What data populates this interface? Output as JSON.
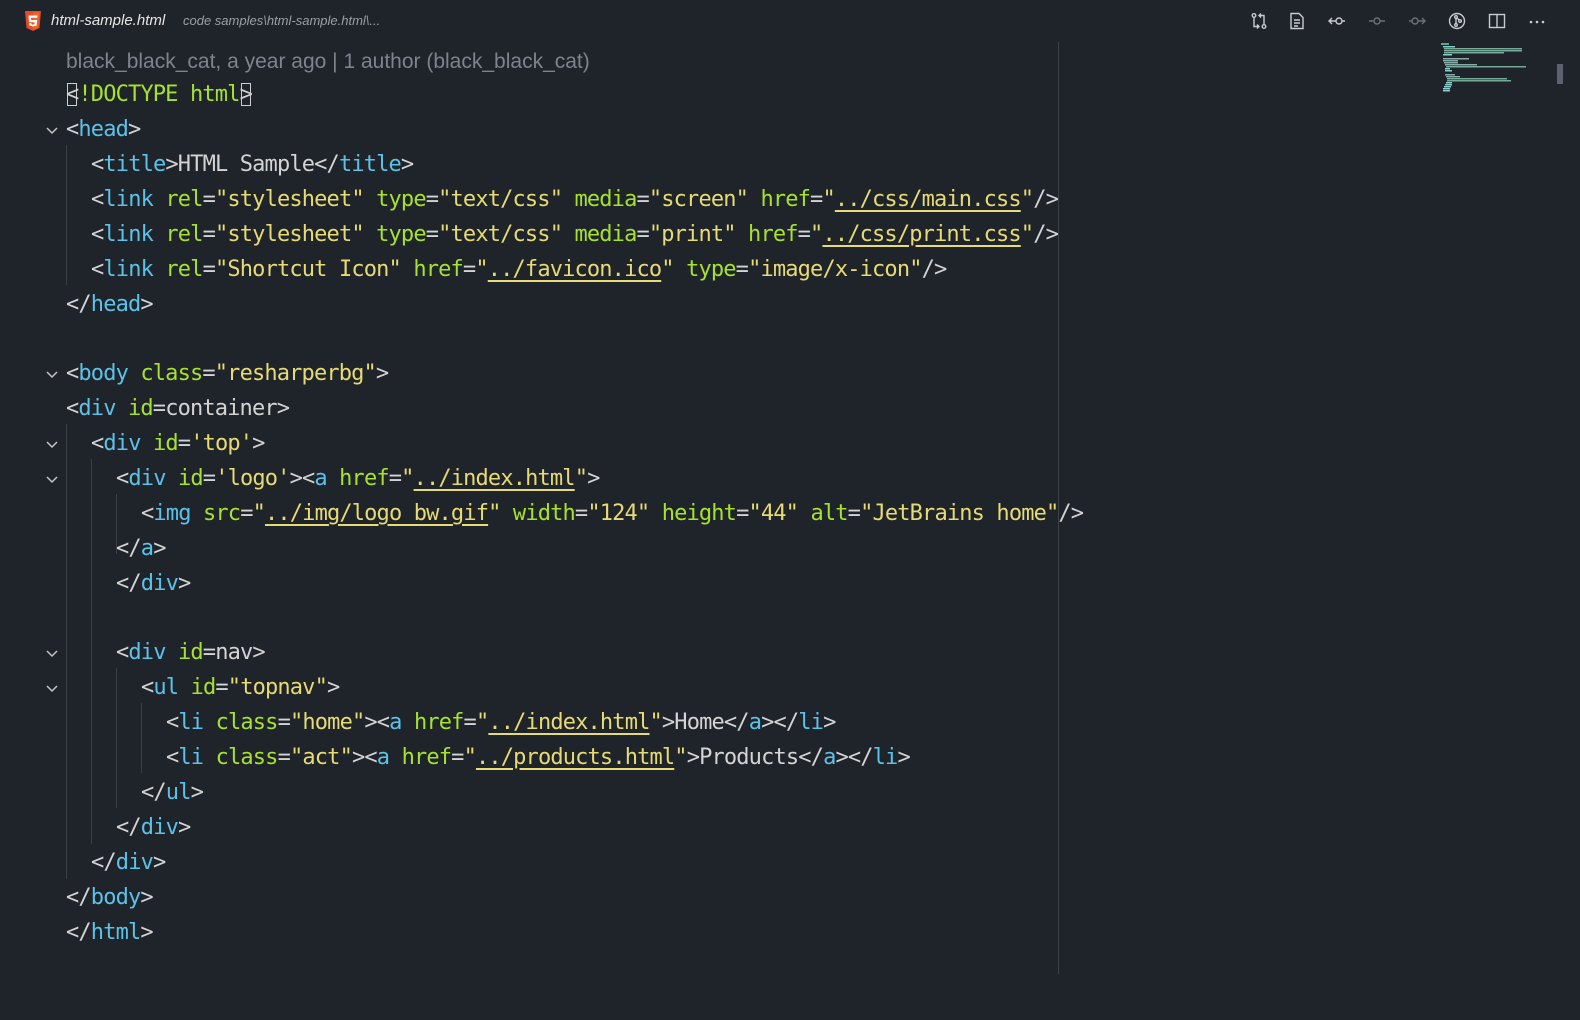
{
  "tab": {
    "file_name": "html-sample.html",
    "file_path": "code samples\\html-sample.html\\..."
  },
  "toolbar": {
    "icons": [
      "compare-changes-icon",
      "preview-icon",
      "git-previous-icon",
      "git-timeline-icon",
      "git-next-icon",
      "git-graph-icon",
      "split-editor-icon",
      "more-actions-icon"
    ]
  },
  "editor": {
    "blame": "black_black_cat, a year ago | 1 author (black_black_cat)",
    "lines": [
      {
        "l1": "<",
        "l2": "!DOCTYPE",
        "l3": " html",
        "l4": ">"
      },
      {
        "o": "<",
        "tag": "head",
        "c": ">"
      },
      {
        "o": "<",
        "tag": "title",
        "m": ">HTML Sample</",
        "tag2": "title",
        "c": ">"
      },
      {
        "o": "<",
        "tag": "link",
        "a1": " rel",
        "e1": "=",
        "s1": "\"stylesheet\"",
        "a2": " type",
        "e2": "=",
        "s2": "\"text/css\"",
        "a3": " media",
        "e3": "=",
        "s3": "\"screen\"",
        "a4": " href",
        "e4": "=",
        "q1": "\"",
        "u": "../css/main.css",
        "q2": "\"",
        "c": "/>"
      },
      {
        "o": "<",
        "tag": "link",
        "a1": " rel",
        "e1": "=",
        "s1": "\"stylesheet\"",
        "a2": " type",
        "e2": "=",
        "s2": "\"text/css\"",
        "a3": " media",
        "e3": "=",
        "s3": "\"print\"",
        "a4": " href",
        "e4": "=",
        "q1": "\"",
        "u": "../css/print.css",
        "q2": "\"",
        "c": "/>"
      },
      {
        "o": "<",
        "tag": "link",
        "a1": " rel",
        "e1": "=",
        "s1": "\"Shortcut Icon\"",
        "a2": " href",
        "e2": "=",
        "q1": "\"",
        "u": "../favicon.ico",
        "q2": "\"",
        "a3": " type",
        "e3": "=",
        "s3": "\"image/x-icon\"",
        "c": "/>"
      },
      {
        "o": "</",
        "tag": "head",
        "c": ">"
      },
      {
        "o": "<",
        "tag": "body",
        "a1": " class",
        "e1": "=",
        "s1": "\"resharperbg\"",
        "c": ">"
      },
      {
        "o": "<",
        "tag": "div",
        "a1": " id",
        "e1": "=",
        "v1": "container",
        "c": ">"
      },
      {
        "o": "<",
        "tag": "div",
        "a1": " id",
        "e1": "=",
        "s1": "'top'",
        "c": ">"
      },
      {
        "o": "<",
        "tag": "div",
        "a1": " id",
        "e1": "=",
        "s1": "'logo'",
        "m": "><",
        "tag2": "a",
        "a2": " href",
        "e2": "=",
        "q1": "\"",
        "u": "../index.html",
        "q2": "\"",
        "c": ">"
      },
      {
        "o": "<",
        "tag": "img",
        "a1": " src",
        "e1": "=",
        "q1": "\"",
        "u": "../img/logo_bw.gif",
        "q2": "\"",
        "a2": " width",
        "e2": "=",
        "s2": "\"124\"",
        "a3": " height",
        "e3": "=",
        "s3": "\"44\"",
        "a4": " alt",
        "e4": "=",
        "s4": "\"JetBrains home\"",
        "c": "/>"
      },
      {
        "o": "</",
        "tag": "a",
        "c": ">"
      },
      {
        "o": "</",
        "tag": "div",
        "c": ">"
      },
      {
        "o": "<",
        "tag": "div",
        "a1": " id",
        "e1": "=",
        "v1": "nav",
        "c": ">"
      },
      {
        "o": "<",
        "tag": "ul",
        "a1": " id",
        "e1": "=",
        "s1": "\"topnav\"",
        "c": ">"
      },
      {
        "o": "<",
        "tag": "li",
        "a1": " class",
        "e1": "=",
        "s1": "\"home\"",
        "m": "><",
        "tag2": "a",
        "a2": " href",
        "e2": "=",
        "q1": "\"",
        "u": "../index.html",
        "q2": "\"",
        "m2": ">Home</",
        "tag3": "a",
        "m3": "></",
        "tag4": "li",
        "c": ">"
      },
      {
        "o": "<",
        "tag": "li",
        "a1": " class",
        "e1": "=",
        "s1": "\"act\"",
        "m": "><",
        "tag2": "a",
        "a2": " href",
        "e2": "=",
        "q1": "\"",
        "u": "../products.html",
        "q2": "\"",
        "m2": ">Products</",
        "tag3": "a",
        "m3": "></",
        "tag4": "li",
        "c": ">"
      },
      {
        "o": "</",
        "tag": "ul",
        "c": ">"
      },
      {
        "o": "</",
        "tag": "div",
        "c": ">"
      },
      {
        "o": "</",
        "tag": "div",
        "c": ">"
      },
      {
        "o": "</",
        "tag": "body",
        "c": ">"
      },
      {
        "o": "</",
        "tag": "html",
        "c": ">"
      }
    ]
  }
}
